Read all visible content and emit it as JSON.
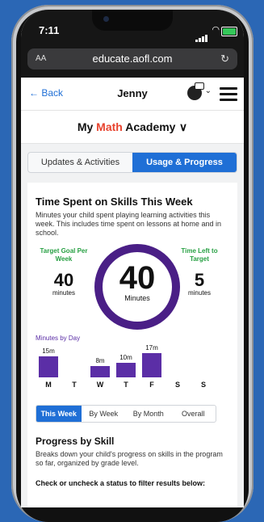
{
  "status": {
    "time": "7:11"
  },
  "browser": {
    "text_size": "AA",
    "url": "educate.aofl.com",
    "reload": "↻"
  },
  "nav": {
    "back_label": "← Back",
    "child_name": "Jenny"
  },
  "product": {
    "name_prefix": "My ",
    "name_brand": "Math",
    "name_suffix": " Academy",
    "chevron": "∨"
  },
  "tabs": [
    "Updates & Activities",
    "Usage & Progress"
  ],
  "time_spent": {
    "title": "Time Spent on Skills This Week",
    "description": "Minutes your child spent playing learning activities this week. This includes time spent on lessons at home and in school.",
    "goal_label": "Target Goal Per Week",
    "goal_value": "40",
    "goal_unit": "minutes",
    "center_value": "40",
    "center_unit": "Minutes",
    "left_label": "Time Left to Target",
    "left_value": "5",
    "left_unit": "minutes"
  },
  "chart_data": {
    "type": "bar",
    "title": "Minutes by Day",
    "categories": [
      "M",
      "T",
      "W",
      "T",
      "F",
      "S",
      "S"
    ],
    "values": [
      15,
      0,
      8,
      10,
      17,
      0,
      0
    ],
    "value_labels": [
      "15m",
      "",
      "8m",
      "10m",
      "17m",
      "",
      ""
    ],
    "ylim": [
      0,
      17
    ]
  },
  "range_tabs": [
    "This Week",
    "By Week",
    "By Month",
    "Overall"
  ],
  "progress": {
    "title": "Progress by Skill",
    "description": "Breaks down your child's progress on skills in the program so far, organized by grade level.",
    "filter_hint": "Check or uncheck a status to filter results below:"
  },
  "colors": {
    "accent": "#1f6fd6",
    "brand_purple": "#5b2ea6",
    "goal_green": "#27a043",
    "background": "#2b67b5"
  }
}
